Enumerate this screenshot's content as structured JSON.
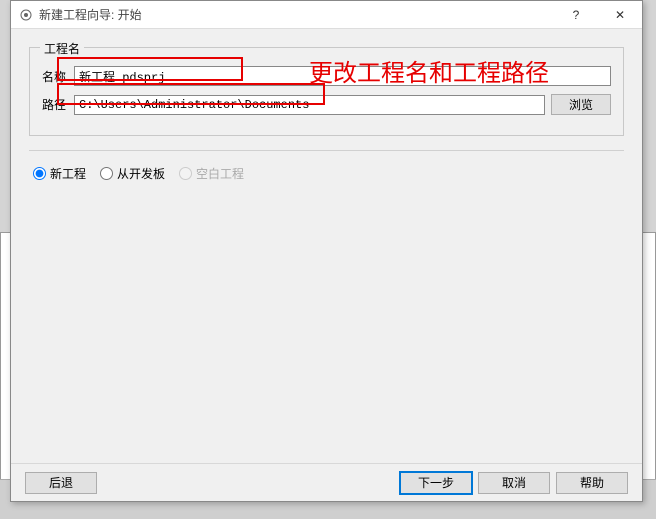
{
  "window": {
    "title": "新建工程向导: 开始",
    "help_symbol": "?",
    "close_symbol": "✕"
  },
  "group": {
    "title": "工程名",
    "name_label": "名称",
    "name_value": "新工程.pdsprj",
    "path_label": "路径",
    "path_value": "C:\\Users\\Administrator\\Documents",
    "browse_label": "浏览"
  },
  "radios": {
    "new_project": "新工程",
    "from_board": "从开发板",
    "blank_project": "空白工程"
  },
  "annotation": "更改工程名和工程路径",
  "buttons": {
    "back": "后退",
    "next": "下一步",
    "cancel": "取消",
    "help": "帮助"
  }
}
